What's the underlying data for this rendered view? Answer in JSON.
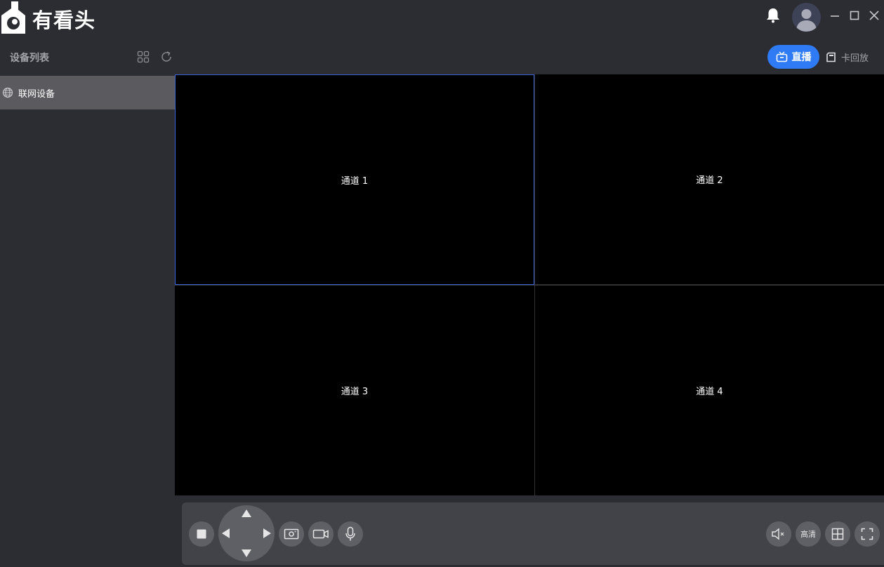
{
  "app": {
    "name": "有看头",
    "logo_icon": "camera-logo-icon"
  },
  "titlebar": {
    "icons": [
      "bell-icon",
      "avatar",
      "minimize-icon",
      "maximize-icon",
      "close-icon"
    ]
  },
  "sidebar": {
    "title": "设备列表",
    "toolbar_icons": [
      "grid-view-icon",
      "refresh-icon"
    ],
    "items": [
      {
        "label": "联网设备",
        "icon": "globe-icon",
        "selected": true
      }
    ]
  },
  "mode_tabs": {
    "live_label": "直播",
    "playback_label": "卡回放",
    "active": "live"
  },
  "channels": [
    {
      "label": "通道 1",
      "selected": true
    },
    {
      "label": "通道 2",
      "selected": false
    },
    {
      "label": "通道 3",
      "selected": false
    },
    {
      "label": "通道 4",
      "selected": false
    }
  ],
  "controls": {
    "hd_label": "高清",
    "left_icons": [
      "stop-icon",
      "ptz-pad",
      "snapshot-icon",
      "record-icon",
      "microphone-icon"
    ],
    "right_icons": [
      "mute-icon",
      "hd-toggle",
      "split-screen-icon",
      "fullscreen-icon"
    ]
  },
  "colors": {
    "accent": "#2f7bf6",
    "background": "#2c2d33",
    "selected_item": "#5a5a5f",
    "selected_cell_border": "#3a63d8",
    "control_bar": "#424249",
    "control_button": "#5f5f66"
  }
}
